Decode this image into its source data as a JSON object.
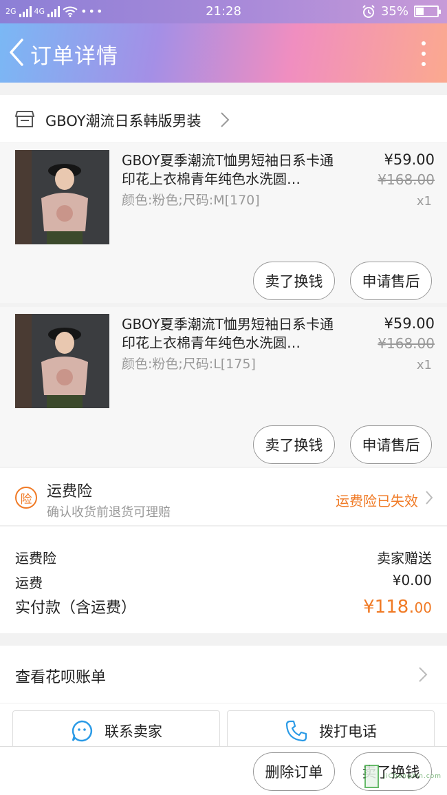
{
  "status_bar": {
    "network_left": "2G",
    "network_right": "4G",
    "time": "21:28",
    "battery": "35%",
    "battery_level": 0.35
  },
  "header": {
    "title": "订单详情"
  },
  "shop": {
    "name": "GBOY潮流日系韩版男装"
  },
  "items": [
    {
      "title": "GBOY夏季潮流T恤男短袖日系卡通印花上衣棉青年纯色水洗圆…",
      "spec": "颜色:粉色;尺码:M[170]",
      "price": "¥59.00",
      "original_price": "¥168.00",
      "quantity": "x1",
      "sell_label": "卖了换钱",
      "aftersale_label": "申请售后"
    },
    {
      "title": "GBOY夏季潮流T恤男短袖日系卡通印花上衣棉青年纯色水洗圆…",
      "spec": "颜色:粉色;尺码:L[175]",
      "price": "¥59.00",
      "original_price": "¥168.00",
      "quantity": "x1",
      "sell_label": "卖了换钱",
      "aftersale_label": "申请售后"
    }
  ],
  "insurance": {
    "badge": "险",
    "title": "运费险",
    "subtitle": "确认收货前退货可理赔",
    "status": "运费险已失效"
  },
  "fees": {
    "insurance_label": "运费险",
    "insurance_value": "卖家赠送",
    "shipping_label": "运费",
    "shipping_value": "¥0.00",
    "total_label": "实付款（含运费）",
    "total_main": "¥118.",
    "total_cents": "00"
  },
  "huabei": {
    "label": "查看花呗账单"
  },
  "contact": {
    "seller_label": "联系卖家",
    "phone_label": "拨打电话"
  },
  "footer": {
    "delete_label": "删除订单",
    "sell_label": "卖了换钱"
  },
  "watermark": {
    "text": "JiChengXin.com"
  },
  "colors": {
    "accent": "#f07a25",
    "link_blue": "#2a9ae6"
  }
}
